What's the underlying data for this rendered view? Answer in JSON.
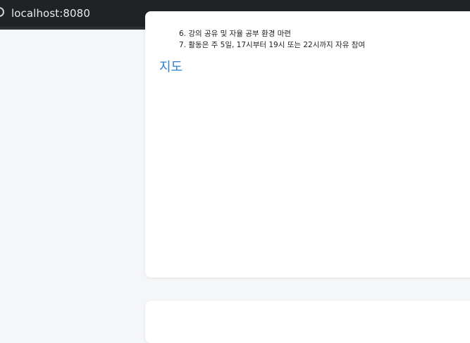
{
  "browser": {
    "url": "localhost:8080"
  },
  "content": {
    "list_items": [
      "6. 강의 공유 및 자율 공부 환경 마련",
      "7. 활동은 주 5일, 17시부터 19시 또는 22시까지 자유 참여"
    ],
    "section_title": "지도"
  }
}
